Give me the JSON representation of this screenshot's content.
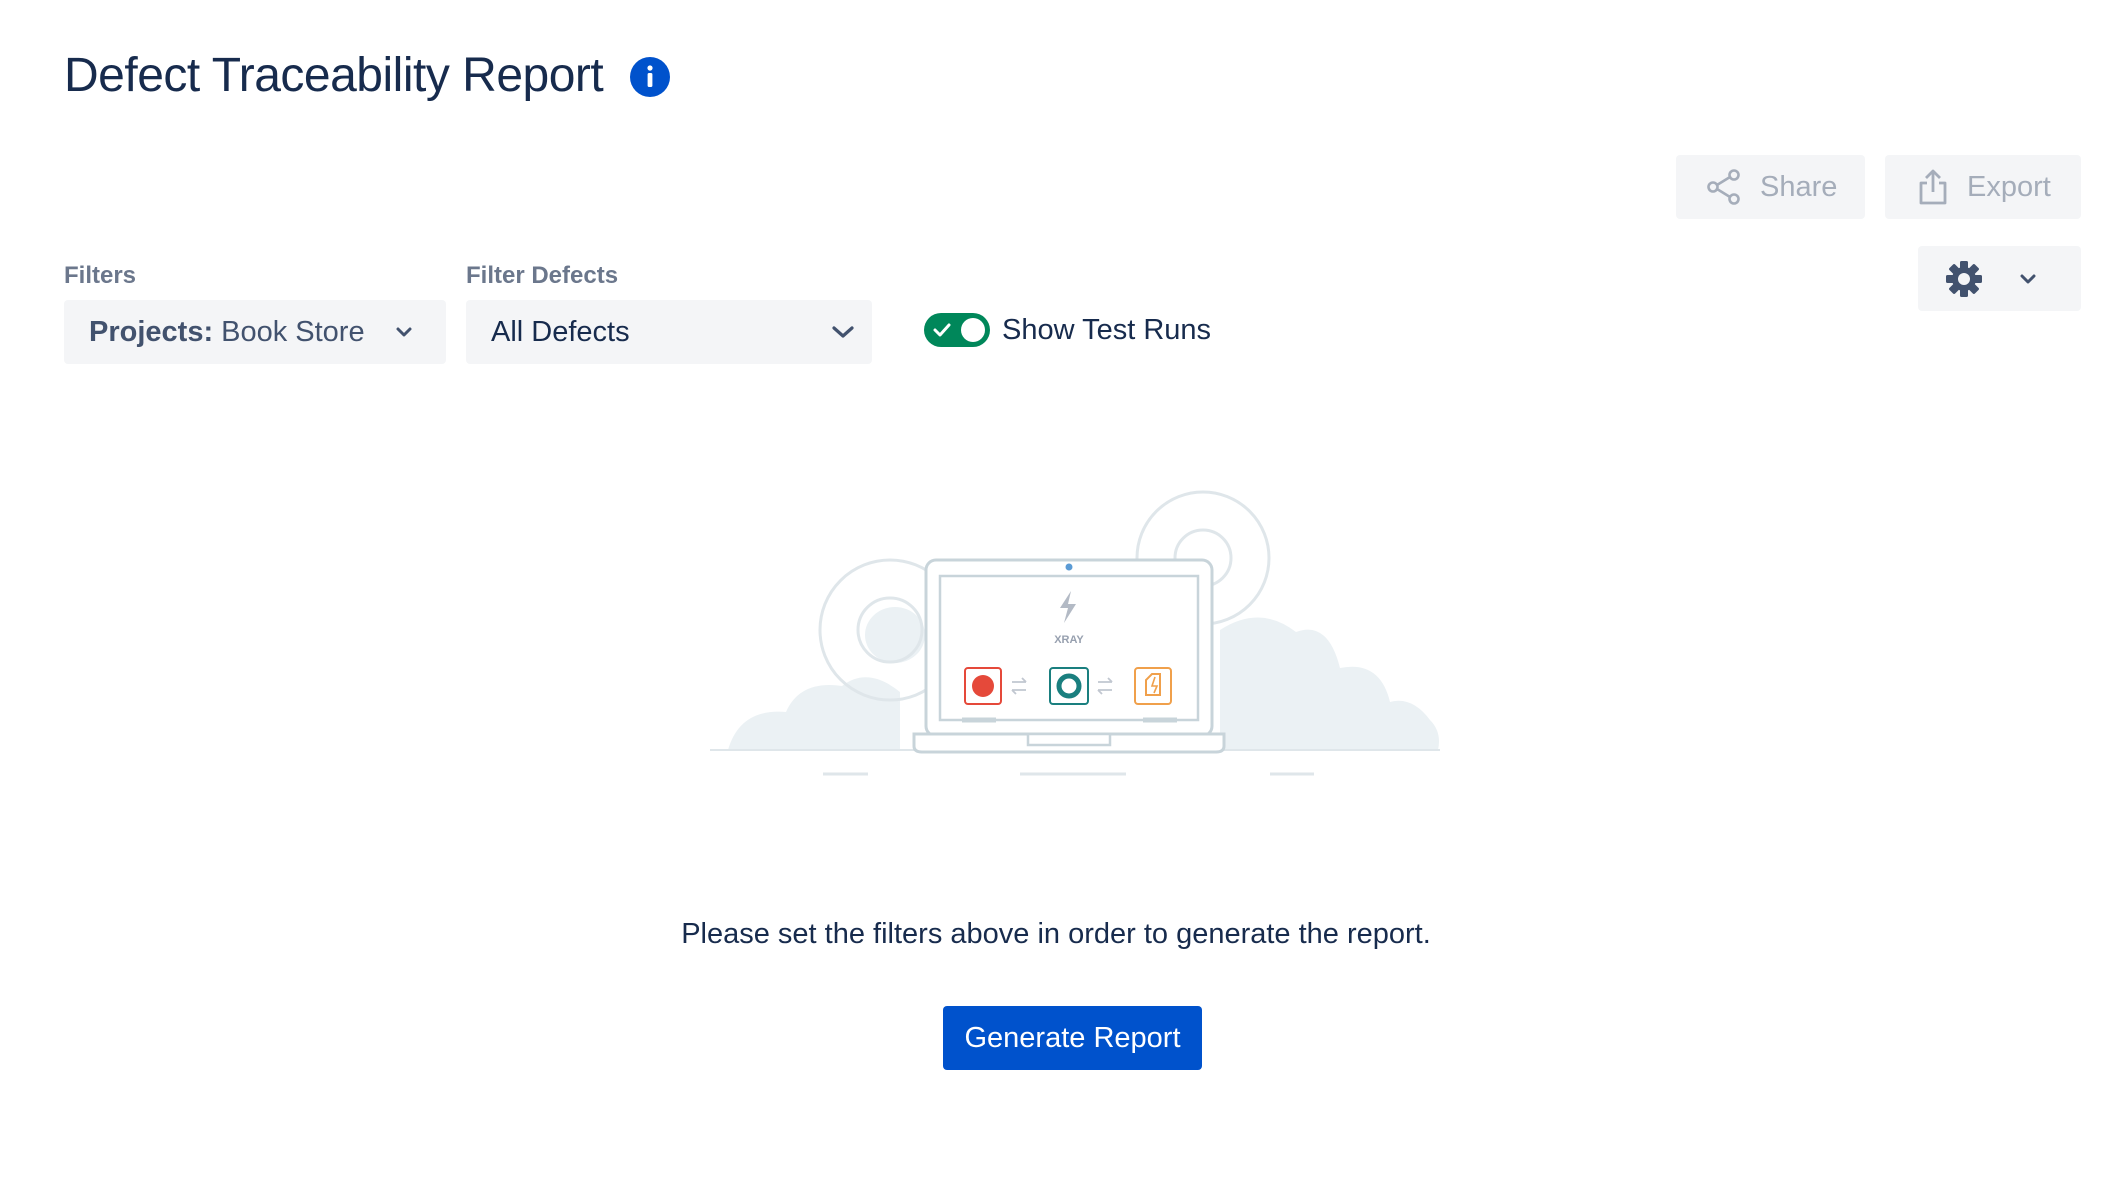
{
  "page": {
    "title": "Defect Traceability Report"
  },
  "toolbar": {
    "share_label": "Share",
    "export_label": "Export"
  },
  "filters": {
    "filters_label": "Filters",
    "projects_prefix": "Projects:",
    "projects_value": "Book Store",
    "defects_label": "Filter Defects",
    "defects_value": "All Defects",
    "show_test_runs_label": "Show Test Runs",
    "show_test_runs_enabled": true
  },
  "illustration": {
    "brand_text": "XRAY"
  },
  "empty_state": {
    "message": "Please set the filters above in order to generate the report.",
    "button_label": "Generate Report"
  },
  "colors": {
    "primary": "#0052cc",
    "toggle_on": "#00875a",
    "text": "#172b4d",
    "muted": "#a5adba"
  }
}
